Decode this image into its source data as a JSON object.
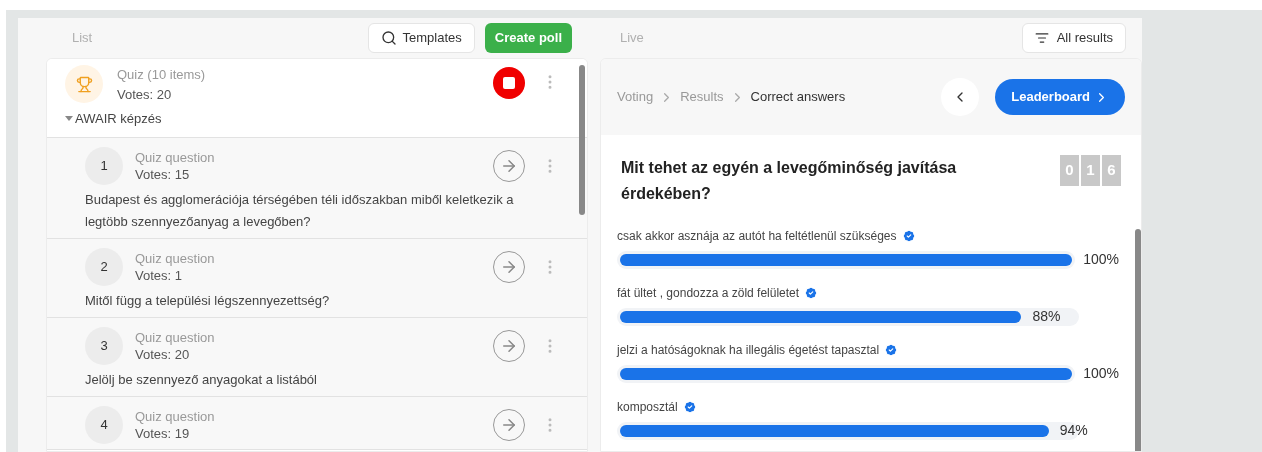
{
  "left": {
    "title": "List",
    "templates_button": "Templates",
    "create_button": "Create poll",
    "quiz": {
      "title": "Quiz (10 items)",
      "votes": "Votes: 20",
      "running": true,
      "group": "AWAIR képzés",
      "expanded": true
    },
    "items": [
      {
        "number": "1",
        "type": "Quiz question",
        "votes": "Votes: 15",
        "question": "Budapest és agglomerációja térségében téli időszakban miből keletkezik a legtöbb szennyezőanyag a levegőben?"
      },
      {
        "number": "2",
        "type": "Quiz question",
        "votes": "Votes: 1",
        "question": "Mitől függ a települési légszennyezettség?"
      },
      {
        "number": "3",
        "type": "Quiz question",
        "votes": "Votes: 20",
        "question": "Jelölj be szennyező anyagokat a listából"
      },
      {
        "number": "4",
        "type": "Quiz question",
        "votes": "Votes: 19"
      }
    ]
  },
  "right": {
    "title": "Live",
    "all_results_button": "All results",
    "breadcrumb": [
      {
        "label": "Voting",
        "selected": false
      },
      {
        "label": "Results",
        "selected": false
      },
      {
        "label": "Correct answers",
        "selected": true
      }
    ],
    "leaderboard_button": "Leaderboard",
    "question": "Mit tehet az egyén a levegőminőség javítása érdekében?",
    "counter": [
      "0",
      "1",
      "6"
    ],
    "answers": [
      {
        "text": "csak akkor asznája az autót ha feltétlenül szükséges",
        "correct": true,
        "level": 1.0,
        "percent": "100%"
      },
      {
        "text": "fát ültet , gondozza a zöld felületet",
        "correct": true,
        "level": 0.88,
        "percent": "88%"
      },
      {
        "text": "jelzi a hatóságoknak ha illegális égetést tapasztal",
        "correct": true,
        "level": 1.0,
        "percent": "100%"
      },
      {
        "text": "komposztál",
        "correct": true,
        "level": 0.94,
        "percent": "94%"
      }
    ]
  }
}
